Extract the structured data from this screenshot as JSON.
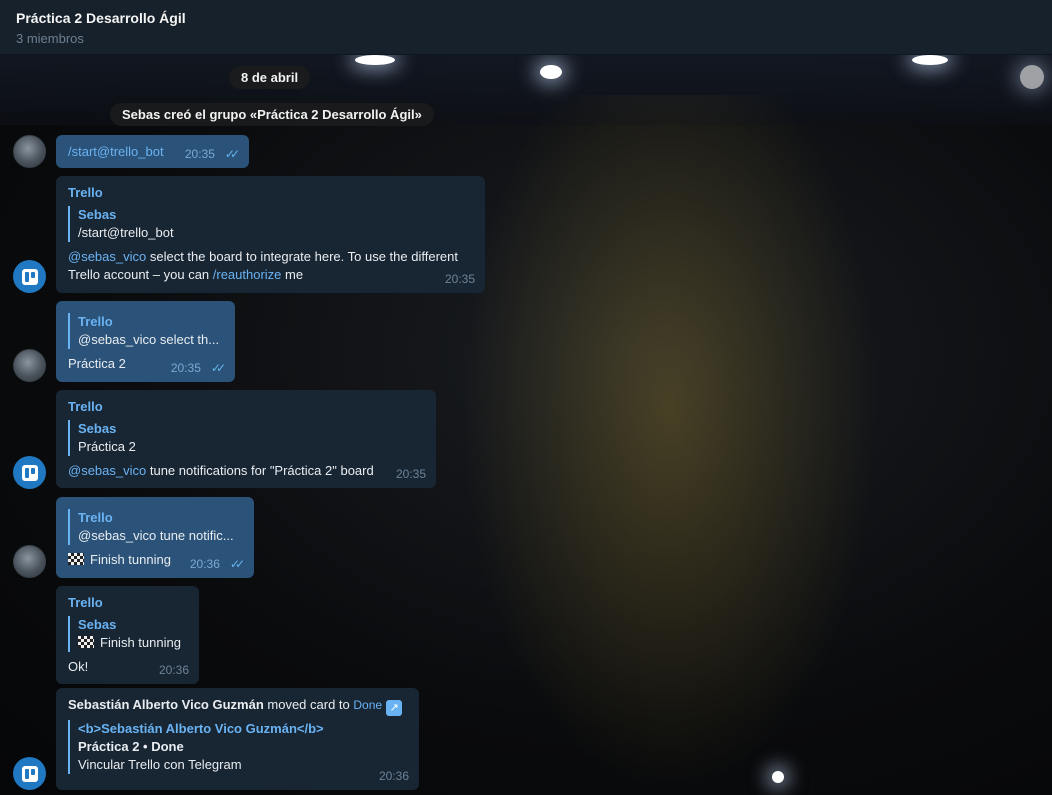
{
  "header": {
    "title": "Práctica 2 Desarrollo Ágil",
    "subtitle": "3 miembros"
  },
  "service": {
    "date": "8 de abril",
    "created": "Sebas creó el grupo «Práctica 2 Desarrollo Ágil»"
  },
  "messages": {
    "m1": {
      "text": "/start@trello_bot",
      "time": "20:35"
    },
    "m2": {
      "sender": "Trello",
      "quote_name": "Sebas",
      "quote_text": "/start@trello_bot",
      "mention": "@sebas_vico",
      "text_a": " select the board to integrate here. To use the different",
      "text_b": "Trello account – you can ",
      "link": "/reauthorize",
      "text_c": " me",
      "time": "20:35"
    },
    "m3": {
      "quote_name": "Trello",
      "quote_text": "@sebas_vico select th...",
      "text": "Práctica 2",
      "time": "20:35"
    },
    "m4": {
      "sender": "Trello",
      "quote_name": "Sebas",
      "quote_text": "Práctica 2",
      "mention": "@sebas_vico",
      "text": " tune notifications for \"Práctica 2\" board",
      "time": "20:35"
    },
    "m5": {
      "quote_name": "Trello",
      "quote_text": "@sebas_vico tune notific...",
      "text": "Finish tunning",
      "time": "20:36"
    },
    "m6": {
      "sender": "Trello",
      "quote_name": "Sebas",
      "quote_text": "Finish tunning",
      "text": "Ok!",
      "time": "20:36"
    },
    "m7": {
      "author": "Sebastián Alberto Vico Guzmán",
      "action": " moved card to ",
      "target": "Done",
      "quote_name": "<b>Sebastián Alberto Vico Guzmán</b>",
      "card_title": "Práctica 2 • Done",
      "card_text": "Vincular Trello con Telegram",
      "time": "20:36"
    }
  },
  "icons": {
    "user_avatar": "user-avatar",
    "bot_avatar": "trello-logo-icon",
    "read": "double-check-icon",
    "flag": "checkered-flag-icon",
    "external": "external-link-icon"
  },
  "colors": {
    "link": "#6ab3f3",
    "incoming_bubble": "#182533",
    "outgoing_bubble": "#2b5278",
    "header": "#17212b"
  }
}
